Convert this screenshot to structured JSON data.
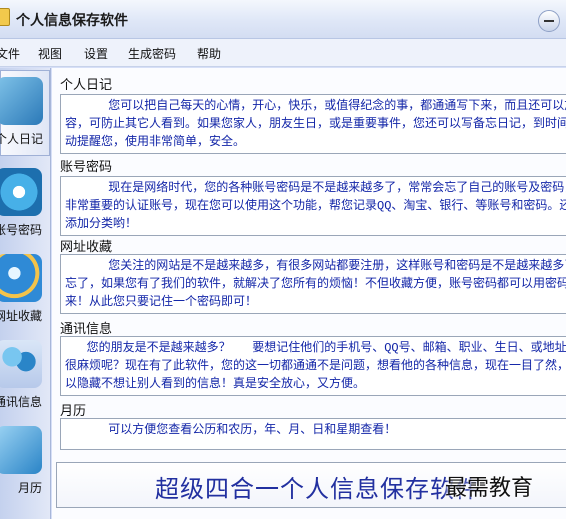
{
  "window": {
    "title": "个人信息保存软件"
  },
  "menu": [
    "文件",
    "视图",
    "设置",
    "生成密码",
    "帮助"
  ],
  "sidebar": {
    "items": [
      {
        "label": "个人日记",
        "icon": "diary-icon"
      },
      {
        "label": "账号密码",
        "icon": "password-icon"
      },
      {
        "label": "网址收藏",
        "icon": "web-icon"
      },
      {
        "label": "通讯信息",
        "icon": "contact-icon"
      },
      {
        "label": "月历",
        "icon": "calendar-icon"
      }
    ]
  },
  "sections": [
    {
      "title": "个人日记",
      "text": "      您可以把自己每天的心情，开心，快乐，或值得纪念的事，都通通写下来，而且还可以加密\n容，可防止其它人看到。如果您家人，朋友生日，或是重要事件，您还可以写备忘日记，到时间\n动提醒您，使用非常简单，安全。"
    },
    {
      "title": "账号密码",
      "text": "      现在是网络时代，您的各种账号密码是不是越来越多了，常常会忘了自己的账号及密码，尤\n非常重要的认证账号，现在您可以使用这个功能，帮您记录QQ、淘宝、银行、等账号和密码。还\n添加分类哟！"
    },
    {
      "title": "网址收藏",
      "text": "      您关注的网站是不是越来越多，有很多网站都要注册，这样账号和密码是不是越来越多了，\n忘了，如果您有了我们的软件，就解决了您所有的烦恼！不但收藏方便，账号密码都可以用密码\n来！从此您只要记住一个密码即可！"
    },
    {
      "title": "通讯信息",
      "text": "   您的朋友是不是越来越多？   要想记住他们的手机号、QQ号、邮箱、职业、生日、或地址等\n很麻烦呢？现在有了此软件，您的这一切都通通不是问题，想看他的各种信息，现在一目了然，\n以隐藏不想让别人看到的信息！真是安全放心，又方便。"
    },
    {
      "title": "月历",
      "text": "      可以方便您查看公历和农历，年、月、日和星期查看！"
    }
  ],
  "banner": "超级四合一个人信息保存软件",
  "watermark": "最需教育",
  "colors": {
    "text_blue": "#1326a8",
    "sidebar_bg": "#c4d1ee",
    "window_bg": "#d6dff7"
  }
}
